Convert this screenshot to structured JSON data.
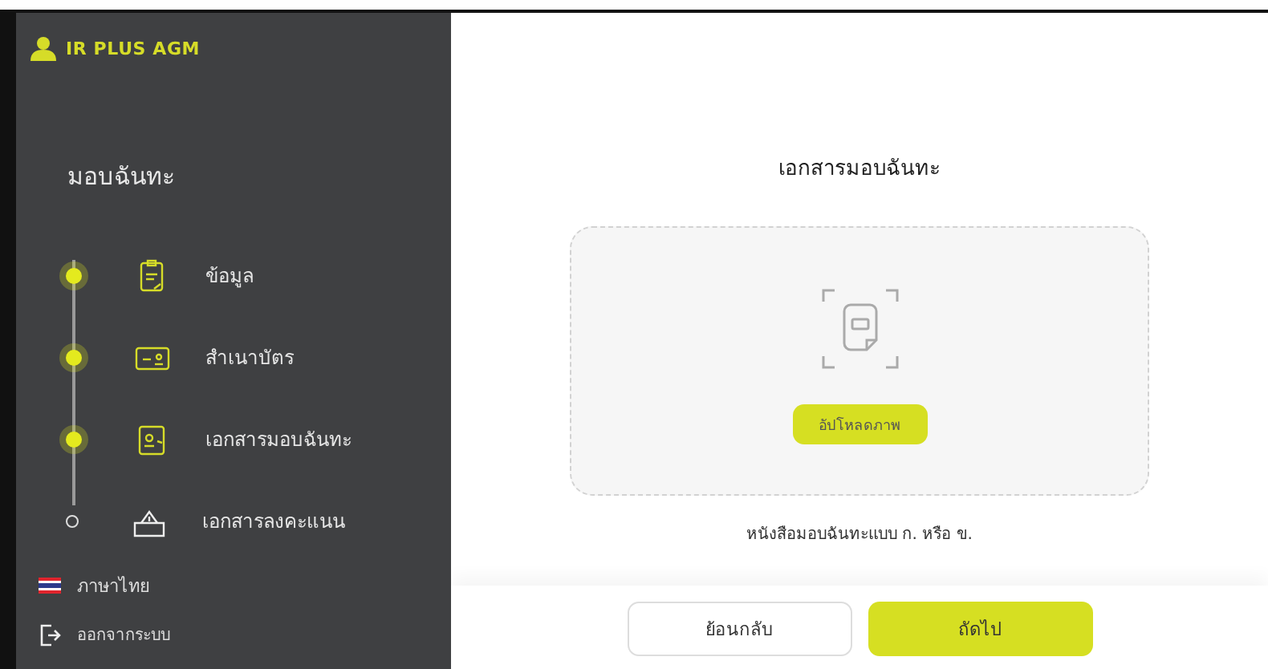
{
  "logo": {
    "text": "IR PLUS AGM"
  },
  "sidebar": {
    "title": "มอบฉันทะ",
    "steps": [
      {
        "label": "ข้อมูล",
        "kind": "clipboard",
        "completed": true
      },
      {
        "label": "สำเนาบัตร",
        "kind": "idcard",
        "completed": true
      },
      {
        "label": "เอกสารมอบฉันทะ",
        "kind": "document",
        "completed": true
      },
      {
        "label": "เอกสารลงคะแนน",
        "kind": "ballot",
        "completed": false
      }
    ],
    "language": "ภาษาไทย",
    "logout": "ออกจากระบบ"
  },
  "main": {
    "heading": "เอกสารมอบฉันทะ",
    "upload_button": "อัปโหลดภาพ",
    "caption": "หนังสือมอบฉันทะแบบ ก. หรือ ข."
  },
  "footer": {
    "back_button": "ย้อนกลับ",
    "next_button": "ถัดไป"
  }
}
